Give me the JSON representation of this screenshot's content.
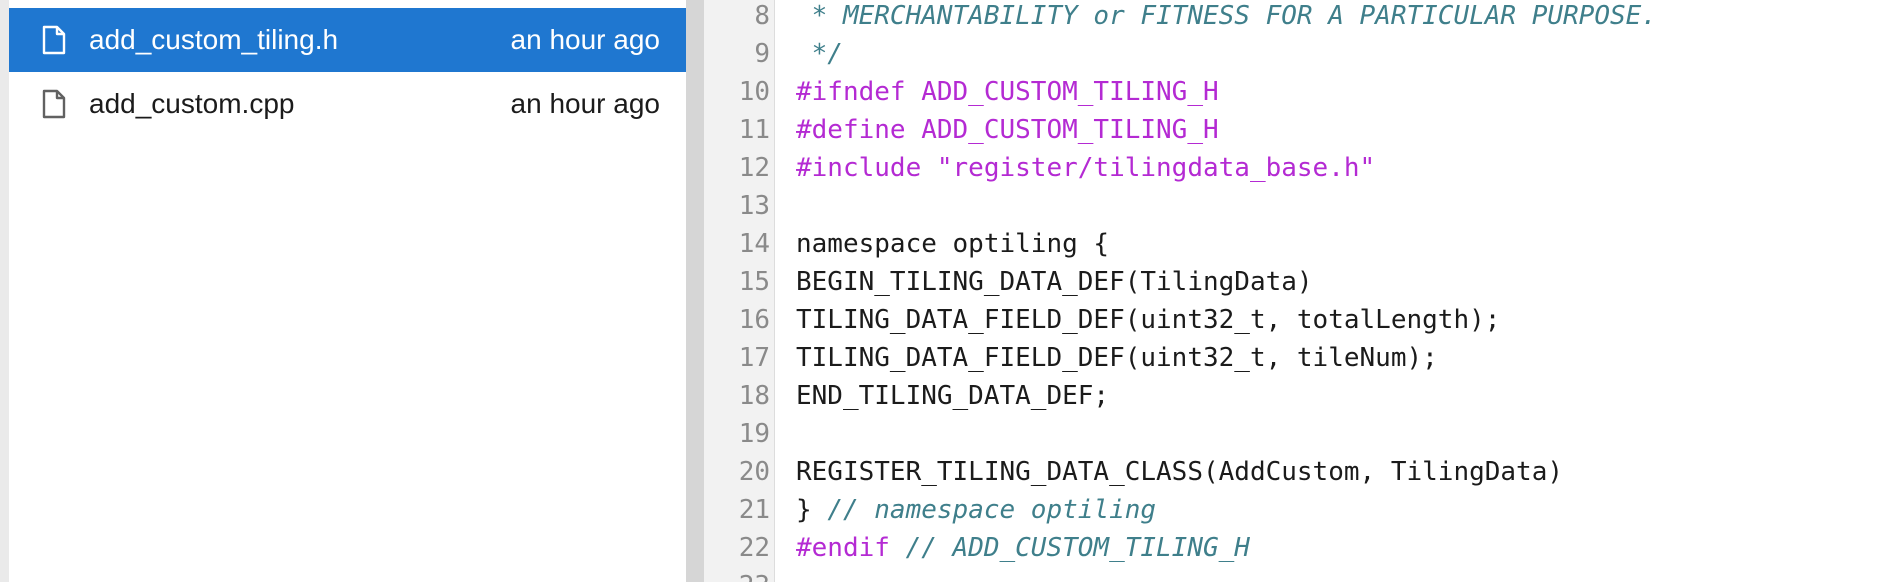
{
  "file_browser": {
    "files": [
      {
        "name": "add_custom_tiling.h",
        "modified": "an hour ago",
        "selected": true,
        "icon": "file-icon"
      },
      {
        "name": "add_custom.cpp",
        "modified": "an hour ago",
        "selected": false,
        "icon": "file-icon"
      }
    ]
  },
  "editor": {
    "lines": [
      {
        "number": "8",
        "tokens": [
          {
            "type": "comment",
            "text": " * MERCHANTABILITY or FITNESS FOR A PARTICULAR PURPOSE."
          }
        ]
      },
      {
        "number": "9",
        "tokens": [
          {
            "type": "comment",
            "text": " */"
          }
        ]
      },
      {
        "number": "10",
        "tokens": [
          {
            "type": "pre",
            "text": "#ifndef ADD_CUSTOM_TILING_H"
          }
        ]
      },
      {
        "number": "11",
        "tokens": [
          {
            "type": "pre",
            "text": "#define ADD_CUSTOM_TILING_H"
          }
        ]
      },
      {
        "number": "12",
        "tokens": [
          {
            "type": "pre",
            "text": "#include \"register/tilingdata_base.h\""
          }
        ]
      },
      {
        "number": "13",
        "tokens": []
      },
      {
        "number": "14",
        "tokens": [
          {
            "type": "plain",
            "text": "namespace optiling {"
          }
        ]
      },
      {
        "number": "15",
        "tokens": [
          {
            "type": "plain",
            "text": "BEGIN_TILING_DATA_DEF(TilingData)"
          }
        ]
      },
      {
        "number": "16",
        "tokens": [
          {
            "type": "plain",
            "text": "TILING_DATA_FIELD_DEF(uint32_t, totalLength);"
          }
        ]
      },
      {
        "number": "17",
        "tokens": [
          {
            "type": "plain",
            "text": "TILING_DATA_FIELD_DEF(uint32_t, tileNum);"
          }
        ]
      },
      {
        "number": "18",
        "tokens": [
          {
            "type": "plain",
            "text": "END_TILING_DATA_DEF;"
          }
        ]
      },
      {
        "number": "19",
        "tokens": []
      },
      {
        "number": "20",
        "tokens": [
          {
            "type": "plain",
            "text": "REGISTER_TILING_DATA_CLASS(AddCustom, TilingData)"
          }
        ]
      },
      {
        "number": "21",
        "tokens": [
          {
            "type": "plain",
            "text": "} "
          },
          {
            "type": "comment",
            "text": "// namespace optiling"
          }
        ]
      },
      {
        "number": "22",
        "tokens": [
          {
            "type": "pre",
            "text": "#endif "
          },
          {
            "type": "comment",
            "text": "// ADD_CUSTOM_TILING_H"
          }
        ]
      },
      {
        "number": "23",
        "tokens": []
      }
    ]
  },
  "colors": {
    "selection": "#1f77d0",
    "comment": "#3f7f8b",
    "preprocessor": "#b42ad3",
    "line_number": "#8a8a8a"
  }
}
